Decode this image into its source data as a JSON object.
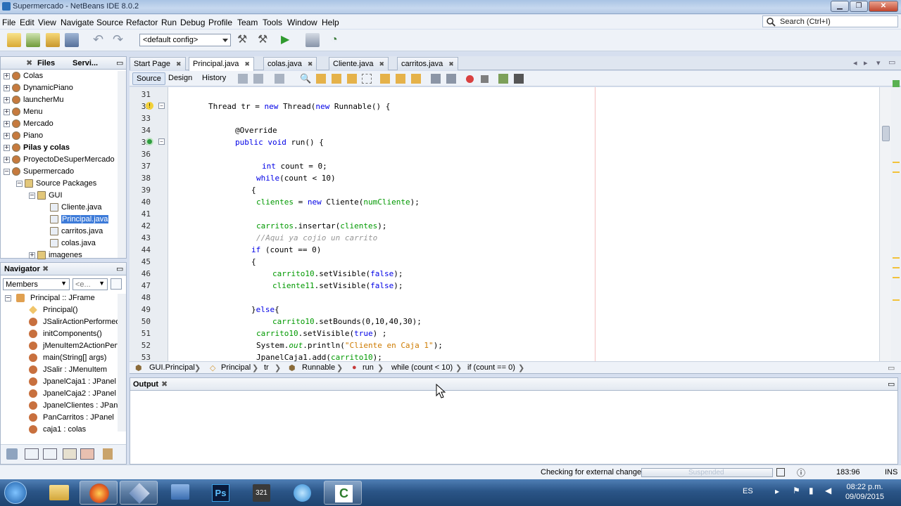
{
  "window": {
    "title": "Supermercado - NetBeans IDE 8.0.2"
  },
  "menu": [
    "File",
    "Edit",
    "View",
    "Navigate",
    "Source",
    "Refactor",
    "Run",
    "Debug",
    "Profile",
    "Team",
    "Tools",
    "Window",
    "Help"
  ],
  "search": {
    "placeholder": "Search (Ctrl+I)"
  },
  "toolbar": {
    "config": "<default config>"
  },
  "projects": {
    "tabs": [
      "Files",
      "Servi..."
    ],
    "items": [
      {
        "label": "Colas",
        "level": 0
      },
      {
        "label": "DynamicPiano",
        "level": 0
      },
      {
        "label": "launcherMu",
        "level": 0
      },
      {
        "label": "Menu",
        "level": 0
      },
      {
        "label": "Mercado",
        "level": 0
      },
      {
        "label": "Piano",
        "level": 0
      },
      {
        "label": "Pilas y colas",
        "level": 0,
        "bold": true
      },
      {
        "label": "ProyectoDeSuperMercado",
        "level": 0
      },
      {
        "label": "Supermercado",
        "level": 0
      },
      {
        "label": "Source Packages",
        "level": 1
      },
      {
        "label": "GUI",
        "level": 2
      },
      {
        "label": "Cliente.java",
        "level": 3
      },
      {
        "label": "Principal.java",
        "level": 3,
        "selected": true
      },
      {
        "label": "carritos.java",
        "level": 3
      },
      {
        "label": "colas.java",
        "level": 3
      },
      {
        "label": "imagenes",
        "level": 2
      }
    ]
  },
  "navigator": {
    "title": "Navigator",
    "filter": "Members",
    "filter2": "<e...",
    "root": "Principal :: JFrame",
    "items": [
      "Principal()",
      "JSalirActionPerformed(",
      "initComponents()",
      "jMenuItem2ActionPerfo",
      "main(String[] args)",
      "JSalir : JMenuItem",
      "JpanelCaja1 : JPanel",
      "JpanelCaja2 : JPanel",
      "JpanelClientes : JPanel",
      "PanCarritos : JPanel",
      "caja1 : colas"
    ]
  },
  "editor": {
    "tabs": [
      "Start Page",
      "Principal.java",
      "colas.java",
      "Cliente.java",
      "carritos.java"
    ],
    "active_tab": "Principal.java",
    "modes": [
      "Source",
      "Design",
      "History"
    ],
    "lines": [
      {
        "n": "31",
        "code": ""
      },
      {
        "n": "32",
        "code": "Thread tr = new Thread(new Runnable() {"
      },
      {
        "n": "33",
        "code": ""
      },
      {
        "n": "34",
        "code": "@Override"
      },
      {
        "n": "35",
        "code": "public void run() {"
      },
      {
        "n": "36",
        "code": ""
      },
      {
        "n": "37",
        "code": "int count = 0;"
      },
      {
        "n": "38",
        "code": "while(count < 10)"
      },
      {
        "n": "39",
        "code": "{"
      },
      {
        "n": "40",
        "code": "clientes = new Cliente(numCliente);"
      },
      {
        "n": "41",
        "code": ""
      },
      {
        "n": "42",
        "code": "carritos.insertar(clientes);"
      },
      {
        "n": "43",
        "code": "//Aqui ya cojio un carrito"
      },
      {
        "n": "44",
        "code": "if (count == 0)"
      },
      {
        "n": "45",
        "code": "{"
      },
      {
        "n": "46",
        "code": "carrito10.setVisible(false);"
      },
      {
        "n": "47",
        "code": "cliente11.setVisible(false);"
      },
      {
        "n": "48",
        "code": ""
      },
      {
        "n": "49",
        "code": "}else{"
      },
      {
        "n": "50",
        "code": "carrito10.setBounds(0,10,40,30);"
      },
      {
        "n": "51",
        "code": "carrito10.setVisible(true) ;"
      },
      {
        "n": "52",
        "code": "System.out.println(\"Cliente en Caja 1\");"
      },
      {
        "n": "53",
        "code": "JpanelCaja1.add(carrito10);"
      }
    ]
  },
  "breadcrumb": [
    "GUI.Principal",
    "Principal",
    "tr",
    "Runnable",
    "run",
    "while (count < 10)",
    "if (count == 0)"
  ],
  "output": {
    "title": "Output"
  },
  "status": {
    "message": "Checking for external changes",
    "progress_label": "Suspended",
    "position": "183:96",
    "mode": "INS"
  },
  "taskbar": {
    "lang": "ES",
    "time": "08:22 p.m.",
    "date": "09/09/2015"
  }
}
